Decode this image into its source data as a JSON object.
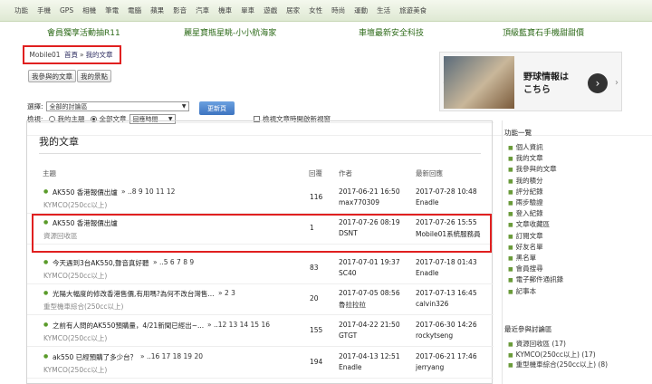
{
  "topnav": [
    "功能",
    "手機",
    "GPS",
    "相機",
    "筆電",
    "電腦",
    "蘋果",
    "影音",
    "汽車",
    "機車",
    "單車",
    "遊戲",
    "居家",
    "女性",
    "時尚",
    "運動",
    "生活",
    "旅遊美食"
  ],
  "promo": [
    "會員獨享活動抽R11",
    "麗星寶瓶星眺-小小航海家",
    "車壇最新安全科技",
    "頂級藍寶石手機甜甜價"
  ],
  "breadcrumb": {
    "site": "Mobile01",
    "home": "首頁",
    "sep": "»",
    "current": "我的文章"
  },
  "buttons": {
    "participated": "我參與的文章",
    "my_view": "我的景點"
  },
  "filter": {
    "select_label": "選擇:",
    "select_value": "全部的討論區",
    "search_label": "檢視:",
    "my_topics": "我的主題",
    "all_articles": "全部文章",
    "sort_value": "回應時間",
    "update": "更新頁",
    "newwin": "檢視文章時開啟新視窗"
  },
  "ad": {
    "line1": "野球情報は",
    "line2": "こちら",
    "arrow": "›"
  },
  "main": {
    "title": "我的文章",
    "headers": {
      "topic": "主題",
      "replies": "回覆",
      "author": "作者",
      "latest": "最新回應"
    },
    "rows": [
      {
        "title": "AK550 香港報價出爐",
        "pages": "» ..8 9 10 11 12",
        "forum": "KYMCO(250cc以上)",
        "replies": "116",
        "date": "2017-06-21 16:50",
        "author": "max770309",
        "ldate": "2017-07-28 10:48",
        "lauthor": "Enadle"
      },
      {
        "title": "AK550 香港報價出爐",
        "pages": "",
        "forum": "資源回收區",
        "replies": "1",
        "date": "2017-07-26 08:19",
        "author": "DSNT",
        "ldate": "2017-07-26 15:55",
        "lauthor": "Mobile01系統服務員"
      },
      {
        "title": "今天遇到3台AK550,聲音真好聽",
        "pages": "» ..5 6 7 8 9",
        "forum": "KYMCO(250cc以上)",
        "replies": "83",
        "date": "2017-07-01 19:37",
        "author": "SC40",
        "ldate": "2017-07-18 01:43",
        "lauthor": "Enadle"
      },
      {
        "title": "光陽大幅度的修改香港售價,有用嗎?為何不改台灣售...",
        "pages": "» 2 3",
        "forum": "重型機車綜合(250cc以上)",
        "replies": "20",
        "date": "2017-07-05 08:56",
        "author": "魯拉拉拉",
        "ldate": "2017-07-13 16:45",
        "lauthor": "calvin326"
      },
      {
        "title": "之前有人問的AK550預購量，4/21新聞已經出~...",
        "pages": "» ..12 13 14 15 16",
        "forum": "KYMCO(250cc以上)",
        "replies": "155",
        "date": "2017-04-22 21:50",
        "author": "GTGT",
        "ldate": "2017-06-30 14:26",
        "lauthor": "rockytseng"
      },
      {
        "title": "ak550 已經預購了多少台？",
        "pages": "» ..16 17 18 19 20",
        "forum": "KYMCO(250cc以上)",
        "replies": "194",
        "date": "2017-04-13 12:51",
        "author": "Enadle",
        "ldate": "2017-06-21 17:46",
        "lauthor": "jerryang"
      }
    ]
  },
  "side": {
    "title": "功能一覽",
    "items": [
      "個人資訊",
      "我的文章",
      "我參與的文章",
      "我的積分",
      "評分紀錄",
      "兩步驗證",
      "登入紀錄",
      "文章收藏區",
      "訂閱文章",
      "好友名單",
      "黑名單",
      "會員搜尋",
      "電子郵件通訊錄",
      "記事本"
    ],
    "recent_title": "最近參與討論區",
    "recent": [
      "資源回收區 (17)",
      "KYMCO(250cc以上) (17)",
      "重型機車綜合(250cc以上) (8)"
    ]
  }
}
